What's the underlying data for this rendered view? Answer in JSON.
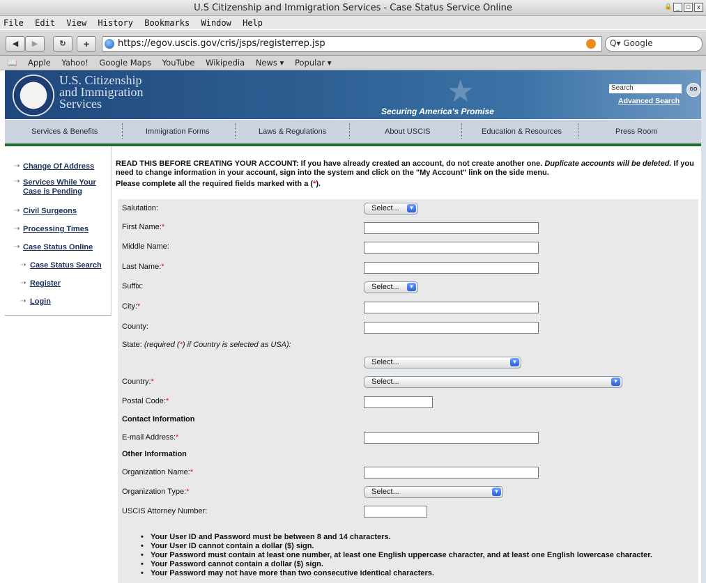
{
  "window": {
    "title": "U.S Citizenship and Immigration Services - Case Status Service Online"
  },
  "menu": [
    "File",
    "Edit",
    "View",
    "History",
    "Bookmarks",
    "Window",
    "Help"
  ],
  "toolbar": {
    "url": "https://egov.uscis.gov/cris/jsps/registerrep.jsp",
    "search_placeholder": "Q▾ Google"
  },
  "bookmarks": [
    "Apple",
    "Yahoo!",
    "Google Maps",
    "YouTube",
    "Wikipedia",
    "News ▾",
    "Popular ▾"
  ],
  "banner": {
    "agency_line1": "U.S. Citizenship",
    "agency_line2": "and Immigration",
    "agency_line3": "Services",
    "tagline": "Securing America's Promise",
    "search_label": "Search",
    "go": "GO",
    "advanced_search": "Advanced Search"
  },
  "nav": [
    "Services & Benefits",
    "Immigration Forms",
    "Laws & Regulations",
    "About USCIS",
    "Education & Resources",
    "Press Room"
  ],
  "sidebar": {
    "items": [
      "Change Of Address",
      "Services While Your Case is Pending",
      "Civil Surgeons",
      "Processing Times",
      "Case Status Online"
    ],
    "subitems": [
      "Case Status Search",
      "Register",
      "Login"
    ]
  },
  "notice": {
    "p1_bold": "READ THIS BEFORE CREATING YOUR ACCOUNT: If you have already created an account, do not create another one.",
    "p1_italic": "Duplicate accounts will be deleted.",
    "p1_rest": "If you need to change information in your account, sign into the system and click on the \"My Account\" link on the side menu.",
    "required_prefix": "Please complete all the required fields marked with a (",
    "required_star": "*",
    "required_suffix": ")."
  },
  "form": {
    "salutation": "Salutation:",
    "first_name": "First Name:",
    "middle_name": "Middle Name:",
    "last_name": "Last Name:",
    "suffix": "Suffix:",
    "city": "City:",
    "county": "County:",
    "state_prefix": "State:",
    "state_note_a": "(required (",
    "state_note_star": "*",
    "state_note_b": ") if Country is selected as USA):",
    "country": "Country:",
    "postal_code": "Postal Code:",
    "contact_heading": "Contact Information",
    "email": "E-mail Address:",
    "other_heading": "Other Information",
    "org_name": "Organization Name:",
    "org_type": "Organization Type:",
    "attorney_number": "USCIS Attorney Number:",
    "select_placeholder": "Select...",
    "star": "*"
  },
  "rules": [
    "Your User ID and Password must be between 8 and 14 characters.",
    "Your User ID cannot contain a dollar ($) sign.",
    "Your Password must contain at least one number, at least one English uppercase character, and at least one English lowercase character.",
    "Your Password cannot contain a dollar ($) sign.",
    "Your Password may not have more than two consecutive identical characters."
  ]
}
